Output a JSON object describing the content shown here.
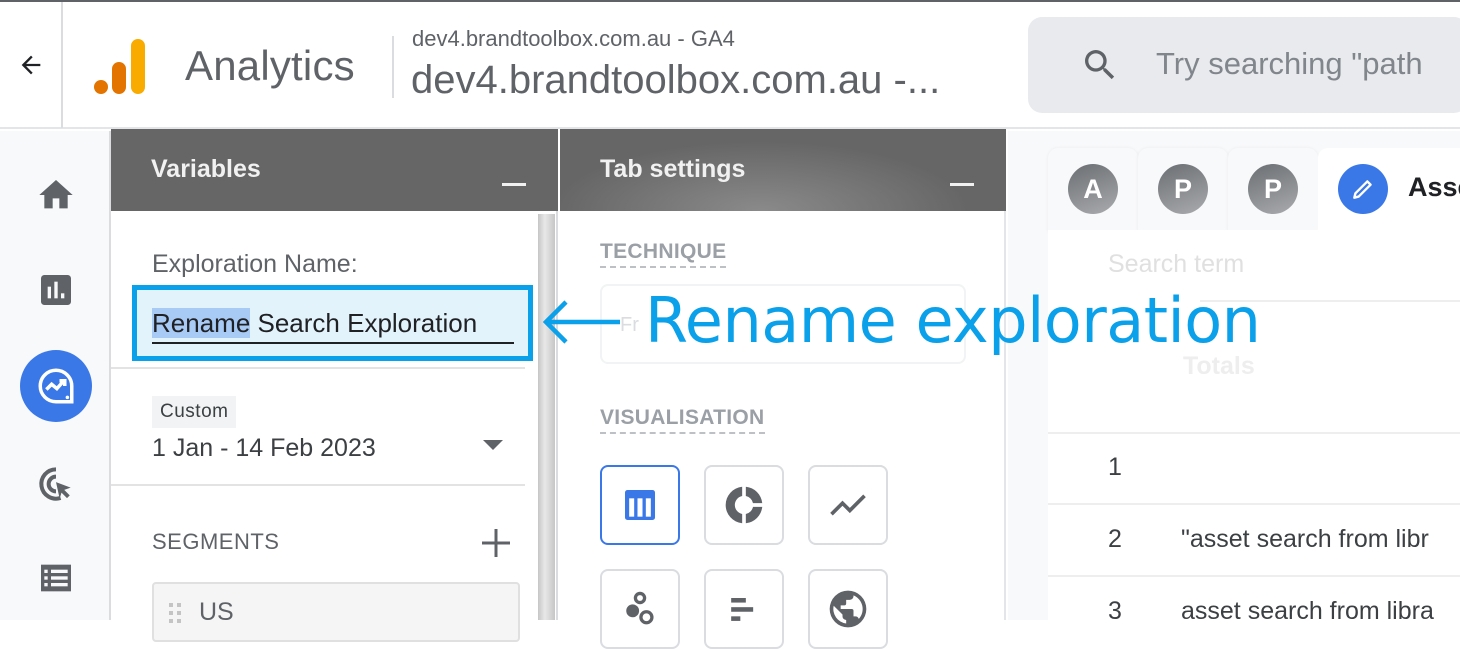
{
  "header": {
    "back_icon": "arrow-back-icon",
    "app_name": "Analytics",
    "logo_colors": [
      "#e37400",
      "#f9ab00"
    ],
    "account_sub": "dev4.brandtoolbox.com.au - GA4",
    "account_main": "dev4.brandtoolbox.com.au -...",
    "search_placeholder": "Try searching \"path"
  },
  "leftnav": {
    "items": [
      {
        "name": "home",
        "icon": "home-icon",
        "active": false
      },
      {
        "name": "reports",
        "icon": "bar-chart-icon",
        "active": false
      },
      {
        "name": "explore",
        "icon": "explore-icon",
        "active": true
      },
      {
        "name": "advertising",
        "icon": "target-cursor-icon",
        "active": false
      },
      {
        "name": "configure",
        "icon": "list-icon",
        "active": false
      }
    ],
    "active_color": "#3b78e7"
  },
  "variables": {
    "title": "Variables",
    "exploration_label": "Exploration Name:",
    "exploration_name_selected": "Rename",
    "exploration_name_rest": " Search Exploration",
    "date_chip": "Custom",
    "date_range": "1 Jan - 14 Feb 2023",
    "segments_label": "SEGMENTS",
    "segments": [
      {
        "label": "US"
      }
    ]
  },
  "tab_settings": {
    "title": "Tab settings",
    "technique_label": "TECHNIQUE",
    "technique_value": "Fr",
    "visualisation_label": "VISUALISATION",
    "visualisations": [
      {
        "name": "table",
        "icon": "table-icon",
        "selected": true
      },
      {
        "name": "donut",
        "icon": "donut-chart-icon",
        "selected": false
      },
      {
        "name": "line",
        "icon": "line-chart-icon",
        "selected": false
      },
      {
        "name": "scatter",
        "icon": "scatter-plot-icon",
        "selected": false
      },
      {
        "name": "bar",
        "icon": "bar-chart-horizontal-icon",
        "selected": false
      },
      {
        "name": "geo",
        "icon": "globe-icon",
        "selected": false
      }
    ]
  },
  "canvas": {
    "tabs": [
      {
        "letter": "A",
        "active": false
      },
      {
        "letter": "P",
        "active": false
      },
      {
        "letter": "P",
        "active": false
      },
      {
        "letter": "",
        "icon": "pencil-icon",
        "label": "Asse",
        "active": true
      }
    ],
    "column_header": "Search term",
    "totals_label": "Totals",
    "rows": [
      {
        "num": "1",
        "text": ""
      },
      {
        "num": "2",
        "text": "\"asset search from libr"
      },
      {
        "num": "3",
        "text": "asset search from libra"
      }
    ]
  },
  "annotation": {
    "text": "Rename exploration",
    "color": "#0aa0ea"
  }
}
